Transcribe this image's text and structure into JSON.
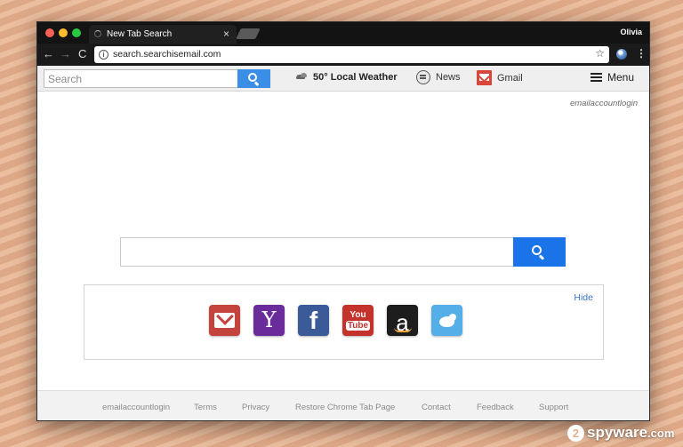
{
  "browser": {
    "tab_title": "New Tab Search",
    "tab_close": "×",
    "profile_name": "Olivia",
    "url": "search.searchisemail.com",
    "info_glyph": "i",
    "star_glyph": "☆",
    "menu_glyph": "⋮",
    "nav": {
      "back": "←",
      "forward": "→",
      "reload": "C"
    }
  },
  "extension_bar": {
    "search_placeholder": "Search",
    "weather_label": "50° Local Weather",
    "news_label": "News",
    "gmail_label": "Gmail",
    "menu_label": "Menu"
  },
  "page": {
    "account_link": "emailaccountlogin",
    "main_search_value": "",
    "quick_links": {
      "hide_label": "Hide",
      "items": [
        {
          "name": "gmail",
          "glyph": ""
        },
        {
          "name": "yahoo",
          "glyph": "Y"
        },
        {
          "name": "facebook",
          "glyph": "f"
        },
        {
          "name": "youtube",
          "glyph_top": "You",
          "glyph_bottom": "Tube"
        },
        {
          "name": "amazon",
          "glyph": "a"
        },
        {
          "name": "twitter",
          "glyph": ""
        }
      ]
    }
  },
  "footer": {
    "links": [
      "emailaccountlogin",
      "Terms",
      "Privacy",
      "Restore Chrome Tab Page",
      "Contact",
      "Feedback",
      "Support"
    ]
  },
  "watermark": {
    "mark": "2",
    "text": "spyware",
    "suffix": ".com"
  },
  "colors": {
    "search_button": "#3a8ee6",
    "main_search_button": "#1a73e8",
    "hide_link": "#3c74c4",
    "gmail_red": "#c4433c",
    "yahoo_purple": "#6a2c9a",
    "facebook_blue": "#3b5a98",
    "youtube_red": "#c3322b",
    "amazon_black": "#1d1d1d",
    "twitter_blue": "#54aee8"
  },
  "icons": [
    "search-icon",
    "weather-icon",
    "news-icon",
    "gmail-icon",
    "menu-icon",
    "star-icon",
    "info-icon",
    "extension-icon"
  ]
}
